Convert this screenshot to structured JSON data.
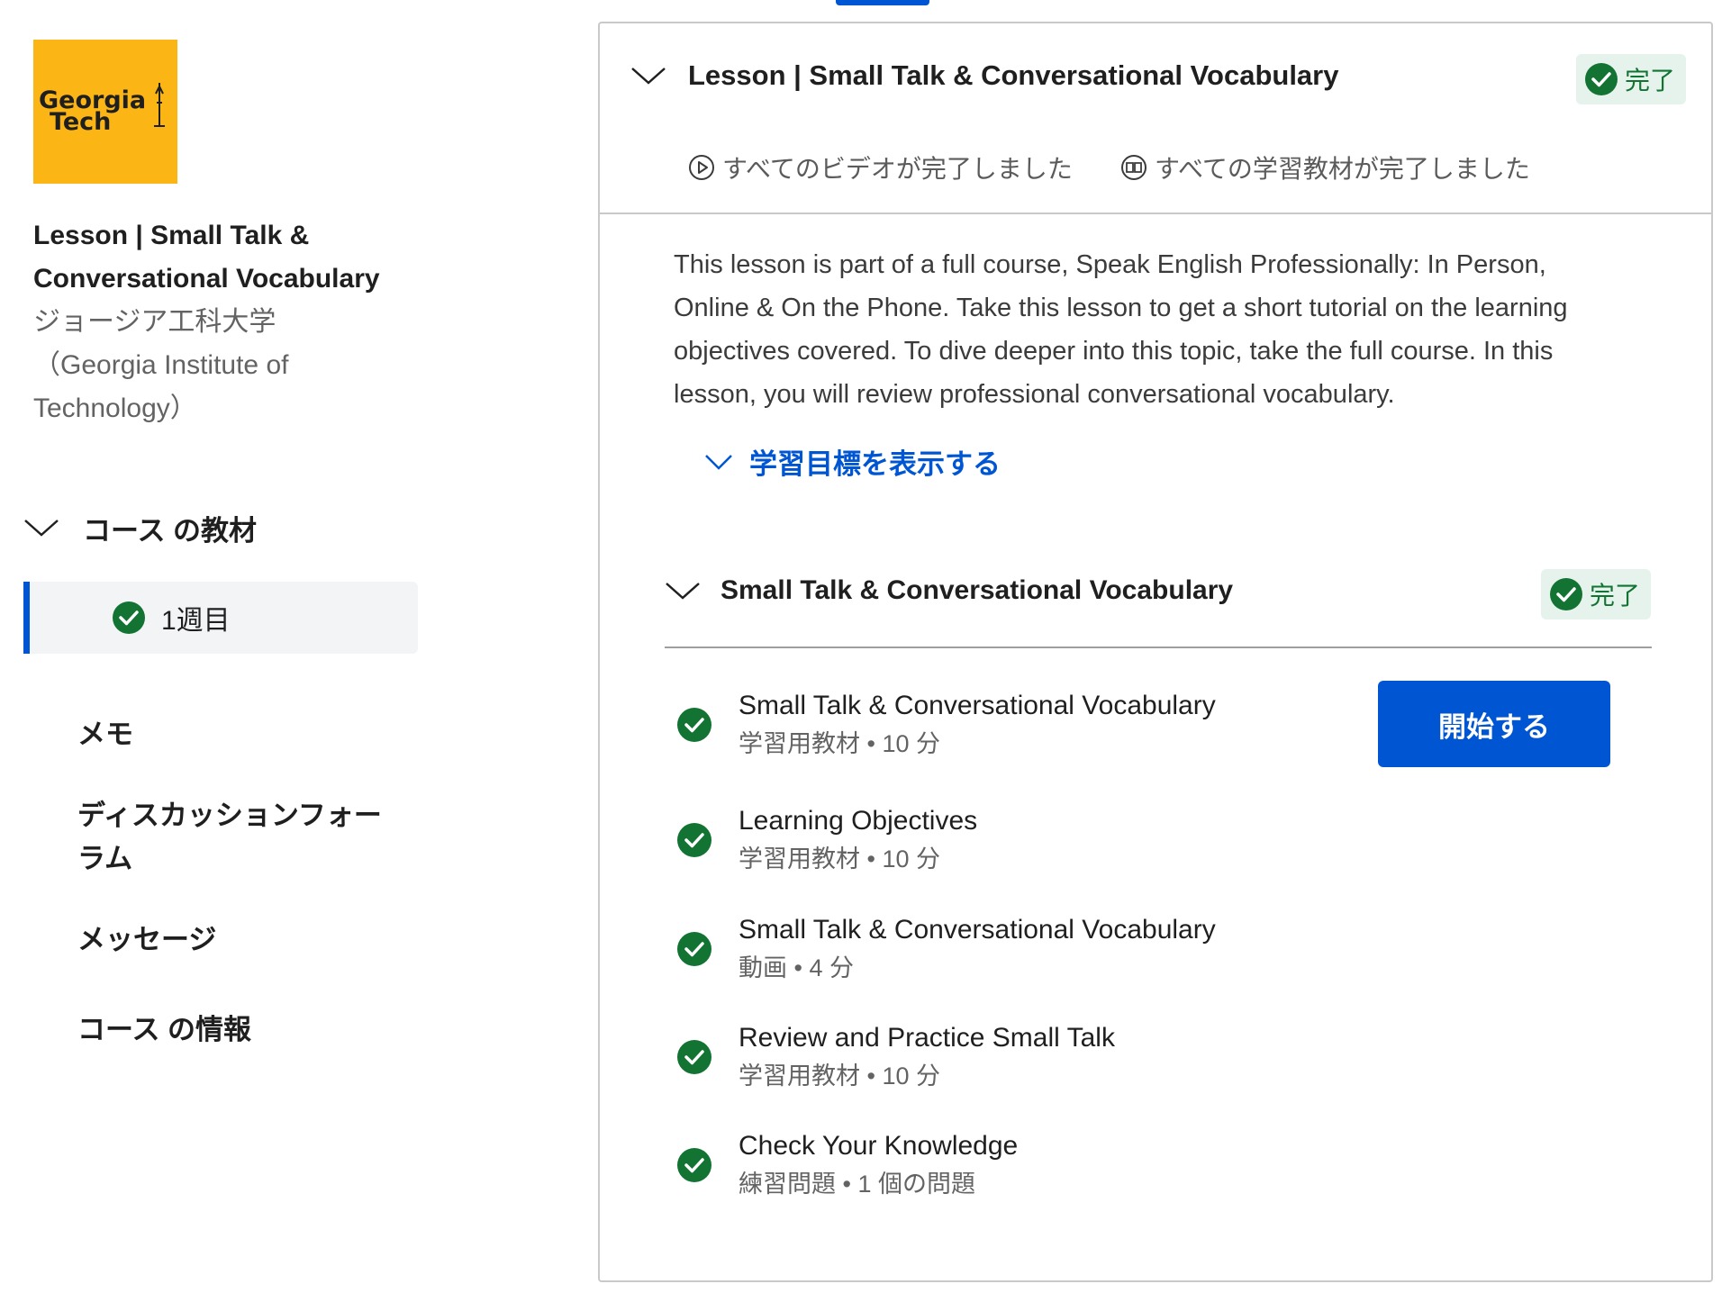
{
  "sidebar": {
    "logo_text_line1": "Georgia",
    "logo_text_line2": "Tech",
    "course_title": "Lesson | Small Talk & Conversational Vocabulary",
    "partner": "ジョージア工科大学（Georgia Institute of Technology）",
    "materials_label": "コース の教材",
    "week_label": "1週目",
    "nav": {
      "notes": "メモ",
      "forum": "ディスカッションフォーラム",
      "messages": "メッセージ",
      "info": "コース の情報"
    }
  },
  "lesson": {
    "title": "Lesson | Small Talk & Conversational Vocabulary",
    "badge": "完了",
    "videos_status": "すべてのビデオが完了しました",
    "readings_status": "すべての学習教材が完了しました",
    "description": "This lesson is part of a full course, Speak English Professionally: In Person, Online & On the Phone. Take this lesson to get a short tutorial on the learning objectives covered. To dive deeper into this topic, take the full course. In this lesson, you will review professional conversational vocabulary.",
    "objectives_link": "学習目標を表示する"
  },
  "module": {
    "title": "Small Talk & Conversational Vocabulary",
    "badge": "完了",
    "start_button": "開始する",
    "items": [
      {
        "title": "Small Talk & Conversational Vocabulary",
        "meta": "学習用教材 • 10 分"
      },
      {
        "title": "Learning Objectives",
        "meta": "学習用教材 • 10 分"
      },
      {
        "title": "Small Talk & Conversational Vocabulary",
        "meta": "動画 • 4 分"
      },
      {
        "title": "Review and Practice Small Talk",
        "meta": "学習用教材 • 10 分"
      },
      {
        "title": "Check Your Knowledge",
        "meta": "練習問題 • 1 個の問題"
      }
    ]
  },
  "colors": {
    "accent": "#0056d2",
    "success": "#137333",
    "success_bg": "#e6f3ec",
    "logo_bg": "#fbb616"
  }
}
